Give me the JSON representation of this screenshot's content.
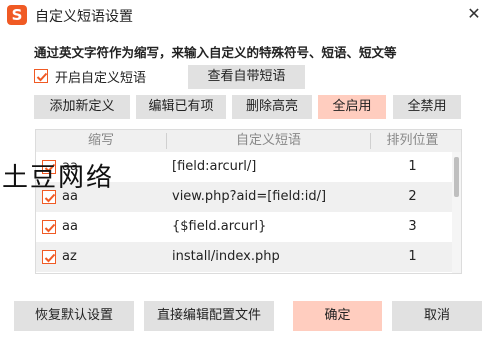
{
  "window": {
    "title": "自定义短语设置",
    "app_icon_glyph": "S",
    "close_glyph": "✕"
  },
  "description": "通过英文字符作为缩写，来输入自定义的特殊符号、短语、短文等",
  "enable_option": {
    "label": "开启自定义短语",
    "checked": true
  },
  "view_button": "查看自带短语",
  "toolbar": {
    "add": "添加新定义",
    "edit": "编辑已有项",
    "delete": "删除高亮",
    "enable_all": "全启用",
    "disable_all": "全禁用"
  },
  "table": {
    "headers": {
      "abbr": "缩写",
      "phrase": "自定义短语",
      "order": "排列位置"
    },
    "rows": [
      {
        "checked": true,
        "abbr": "aa",
        "phrase": "[field:arcurl/]",
        "order": "1"
      },
      {
        "checked": true,
        "abbr": "aa",
        "phrase": "view.php?aid=[field:id/]",
        "order": "2"
      },
      {
        "checked": true,
        "abbr": "aa",
        "phrase": "{$field.arcurl}",
        "order": "3"
      },
      {
        "checked": true,
        "abbr": "az",
        "phrase": "install/index.php",
        "order": "1"
      }
    ]
  },
  "watermark": "土豆网络",
  "footer": {
    "restore_default": "恢复默认设置",
    "edit_config": "直接编辑配置文件",
    "ok": "确定",
    "cancel": "取消"
  },
  "colors": {
    "accent": "#f05a24",
    "accent_button": "#ffcdbf",
    "button": "#e1e1e1",
    "row_alt": "#f0f0f0"
  }
}
